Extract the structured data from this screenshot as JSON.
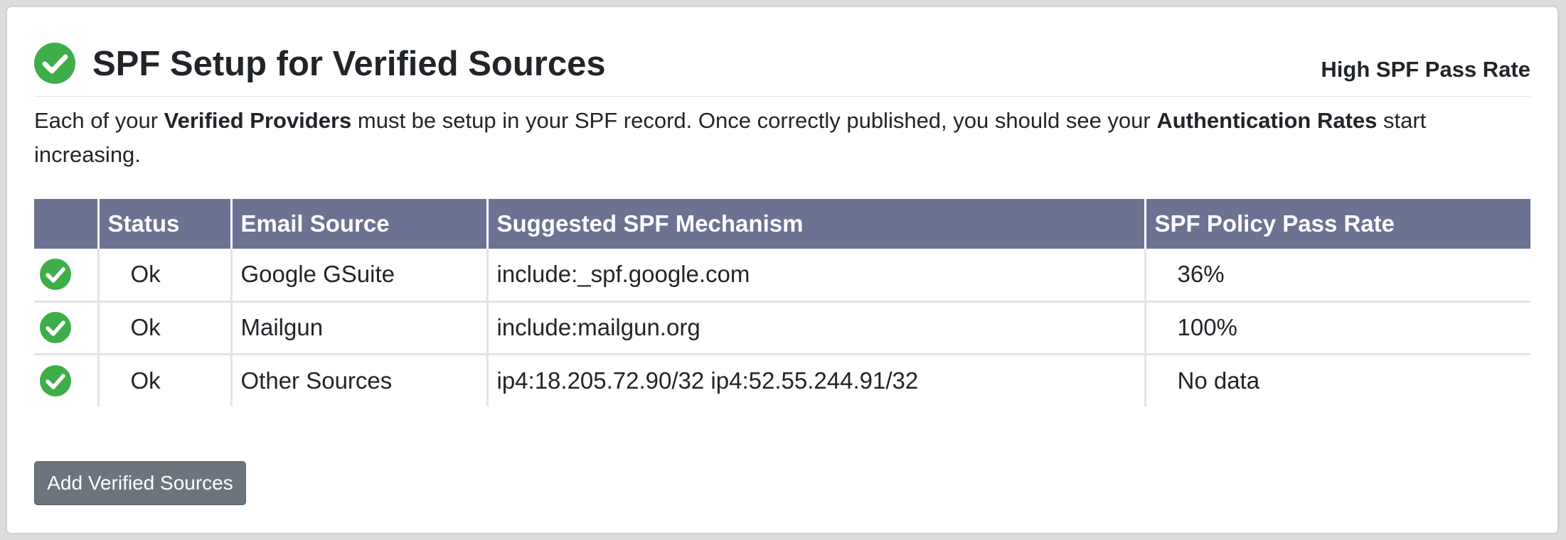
{
  "header": {
    "title": "SPF Setup for Verified Sources",
    "rate_label": "High SPF Pass Rate",
    "status_icon": "check-circle-icon"
  },
  "description": {
    "part1": "Each of your ",
    "bold1": "Verified Providers",
    "part2": " must be setup in your SPF record. Once correctly published, you should see your ",
    "bold2": "Authentication Rates",
    "part3": " start increasing."
  },
  "table": {
    "columns": [
      "",
      "Status",
      "Email Source",
      "Suggested SPF Mechanism",
      "SPF Policy Pass Rate"
    ],
    "rows": [
      {
        "icon": "check-circle-icon",
        "status": "Ok",
        "source": "Google GSuite",
        "mechanism": "include:_spf.google.com",
        "pass_rate": "36%"
      },
      {
        "icon": "check-circle-icon",
        "status": "Ok",
        "source": "Mailgun",
        "mechanism": "include:mailgun.org",
        "pass_rate": "100%"
      },
      {
        "icon": "check-circle-icon",
        "status": "Ok",
        "source": "Other Sources",
        "mechanism": "ip4:18.205.72.90/32 ip4:52.55.244.91/32",
        "pass_rate": "No data"
      }
    ]
  },
  "actions": {
    "add_label": "Add Verified Sources"
  },
  "colors": {
    "success": "#3fae49",
    "table_header": "#6c7291",
    "button": "#6c757d"
  }
}
